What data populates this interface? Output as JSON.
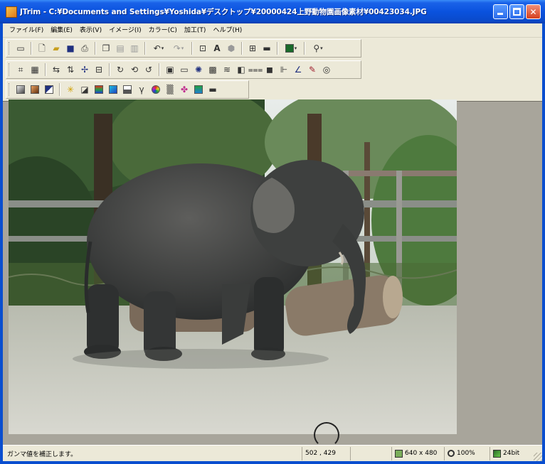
{
  "window": {
    "title": "JTrim - C:¥Documents and Settings¥Yoshida¥デスクトップ¥20000424上野動物園画像素材¥00423034.JPG",
    "icon": "jtrim-app-icon"
  },
  "menu": [
    {
      "label": "ファイル(F)"
    },
    {
      "label": "編集(E)"
    },
    {
      "label": "表示(V)"
    },
    {
      "label": "イメージ(I)"
    },
    {
      "label": "カラー(C)"
    },
    {
      "label": "加工(T)"
    },
    {
      "label": "ヘルプ(H)"
    }
  ],
  "toolbar1": [
    "new-window-icon",
    "new-icon",
    "open-icon",
    "save-icon",
    "print-icon",
    "copy-icon",
    "paste-icon",
    "paste-new-icon",
    "undo-icon",
    "redo-icon",
    "resize-icon",
    "text-icon",
    "shape-icon",
    "grid-icon",
    "frame-icon",
    "color-icon",
    "zoom-icon"
  ],
  "toolbar2": [
    "crop-icon",
    "trim-icon",
    "flip-h-icon",
    "flip-v-icon",
    "rotate-free-icon",
    "fit-icon",
    "rotate-90-icon",
    "rotate-180-icon",
    "rotate-270-icon",
    "border-icon",
    "shadow-icon",
    "brightness-icon",
    "mosaic-icon",
    "wave-icon",
    "emboss-icon",
    "line-icon",
    "fill-icon",
    "edge-icon",
    "pen-icon",
    "brush-icon",
    "spiral-icon"
  ],
  "toolbar3": [
    "gray-icon",
    "sepia-icon",
    "invert-icon",
    "sharpen-icon",
    "blur-icon",
    "hue-icon",
    "saturation-icon",
    "contrast-icon",
    "gamma-icon",
    "balance-icon",
    "noise-icon",
    "posterize-icon",
    "equalize-icon",
    "solarize-icon"
  ],
  "status": {
    "message": "ガンマ値を補正します。",
    "coords": "502 , 429",
    "size": "640 x 480",
    "zoom": "100%",
    "depth": "24bit"
  },
  "colors": {
    "titlebar": "#0A52DE",
    "chrome": "#ECE9D8",
    "workspace": "#A8A59B"
  }
}
